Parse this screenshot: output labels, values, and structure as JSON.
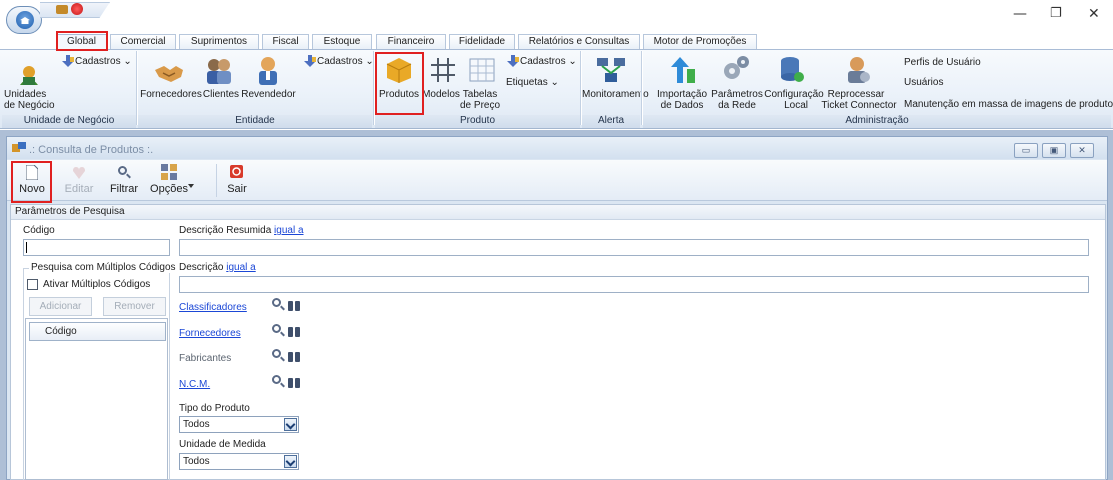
{
  "window": {
    "minimize_glyph": "—",
    "restore_glyph": "❐",
    "close_glyph": "✕"
  },
  "tabs": [
    {
      "label": "Global",
      "active": true
    },
    {
      "label": "Comercial"
    },
    {
      "label": "Suprimentos"
    },
    {
      "label": "Fiscal"
    },
    {
      "label": "Estoque"
    },
    {
      "label": "Financeiro"
    },
    {
      "label": "Fidelidade"
    },
    {
      "label": "Relatórios e Consultas"
    },
    {
      "label": "Motor de Promoções"
    }
  ],
  "ribbon": {
    "unidade": {
      "btn_line1": "Unidades",
      "btn_line2": "de Negócio",
      "cadastros": "Cadastros",
      "group": "Unidade de Negócio"
    },
    "entidade": {
      "fornecedores": "Fornecedores",
      "clientes": "Clientes",
      "revendedor": "Revendedor",
      "cadastros": "Cadastros",
      "group": "Entidade"
    },
    "produto": {
      "produtos": "Produtos",
      "modelos": "Modelos",
      "tabelas_line1": "Tabelas",
      "tabelas_line2": "de Preço",
      "cadastros": "Cadastros",
      "etiquetas": "Etiquetas",
      "group": "Produto"
    },
    "alerta": {
      "monitoramento": "Monitoramento",
      "group": "Alerta"
    },
    "administracao": {
      "importacao_line1": "Importação",
      "importacao_line2": "de Dados",
      "parametros_line1": "Parâmetros",
      "parametros_line2": "da Rede",
      "configuracao_line1": "Configuração",
      "configuracao_line2": "Local",
      "reprocessar_line1": "Reprocessar",
      "reprocessar_line2": "Ticket Connector",
      "perfis": "Perfis de Usuário",
      "usuarios": "Usuários",
      "manutencao": "Manutenção em massa de imagens de produto",
      "group": "Administração"
    },
    "dropdown_arrow": "⌄"
  },
  "child_window": {
    "title": ".: Consulta de Produtos :.",
    "ctrl_minimize": "▭",
    "ctrl_maximize": "▣",
    "ctrl_close": "✕"
  },
  "toolbar": {
    "novo": "Novo",
    "editar": "Editar",
    "filtrar": "Filtrar",
    "opcoes": "Opções",
    "sair": "Sair"
  },
  "search": {
    "header": "Parâmetros de Pesquisa",
    "codigo_label": "Código",
    "codigo_value": "",
    "descricao_resumida_label": "Descrição Resumida",
    "descricao_label": "Descrição",
    "igual_a": "igual a",
    "multi_group": "Pesquisa com Múltiplos Códigos",
    "ativar_multi": "Ativar Múltiplos Códigos",
    "adicionar": "Adicionar",
    "remover": "Remover",
    "list_column": "Código",
    "classificadores": "Classificadores",
    "fornecedores": "Fornecedores",
    "fabricantes": "Fabricantes",
    "ncm": "N.C.M.",
    "tipo_label": "Tipo do Produto",
    "tipo_value": "Todos",
    "unidade_label": "Unidade de Medida",
    "unidade_value": "Todos"
  }
}
